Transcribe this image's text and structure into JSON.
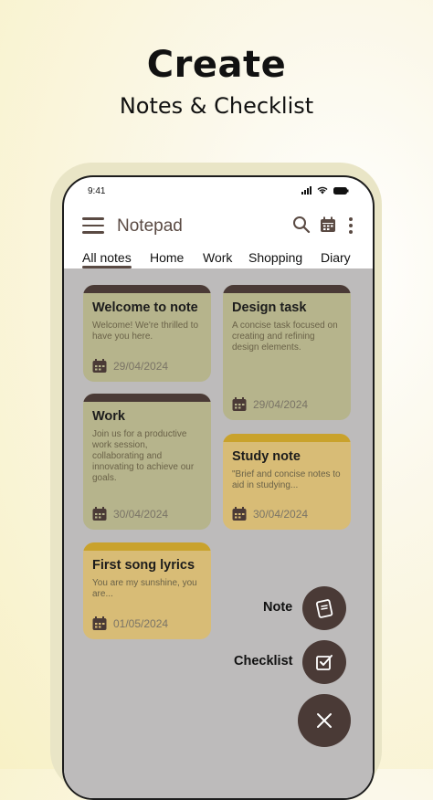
{
  "headline": {
    "title": "Create",
    "subtitle": "Notes & Checklist"
  },
  "status_bar": {
    "time": "9:41"
  },
  "app_bar": {
    "title": "Notepad"
  },
  "tabs": [
    "All notes",
    "Home",
    "Work",
    "Shopping",
    "Diary"
  ],
  "selected_tab": "All notes",
  "notes": [
    {
      "title": "Welcome to note",
      "body": "Welcome! We're thrilled to have you here.",
      "date": "29/04/2024",
      "color": "green"
    },
    {
      "title": "Design task",
      "body": "A concise task focused on creating and refining design elements.",
      "date": "29/04/2024",
      "color": "green"
    },
    {
      "title": "Work",
      "body": "Join us for a productive work session, collaborating and innovating to achieve our goals.",
      "date": "30/04/2024",
      "color": "green"
    },
    {
      "title": "Study note",
      "body": "\"Brief and concise notes to aid in studying...",
      "date": "30/04/2024",
      "color": "tan"
    },
    {
      "title": "First song lyrics",
      "body": "You are my sunshine, you are...",
      "date": "01/05/2024",
      "color": "tan"
    }
  ],
  "fab_menu": {
    "note_label": "Note",
    "checklist_label": "Checklist"
  },
  "colors": {
    "accent": "#4a3a36",
    "green_card": "#b6b48c",
    "tan_card": "#d8bc76",
    "tan_band": "#c9a22c"
  }
}
